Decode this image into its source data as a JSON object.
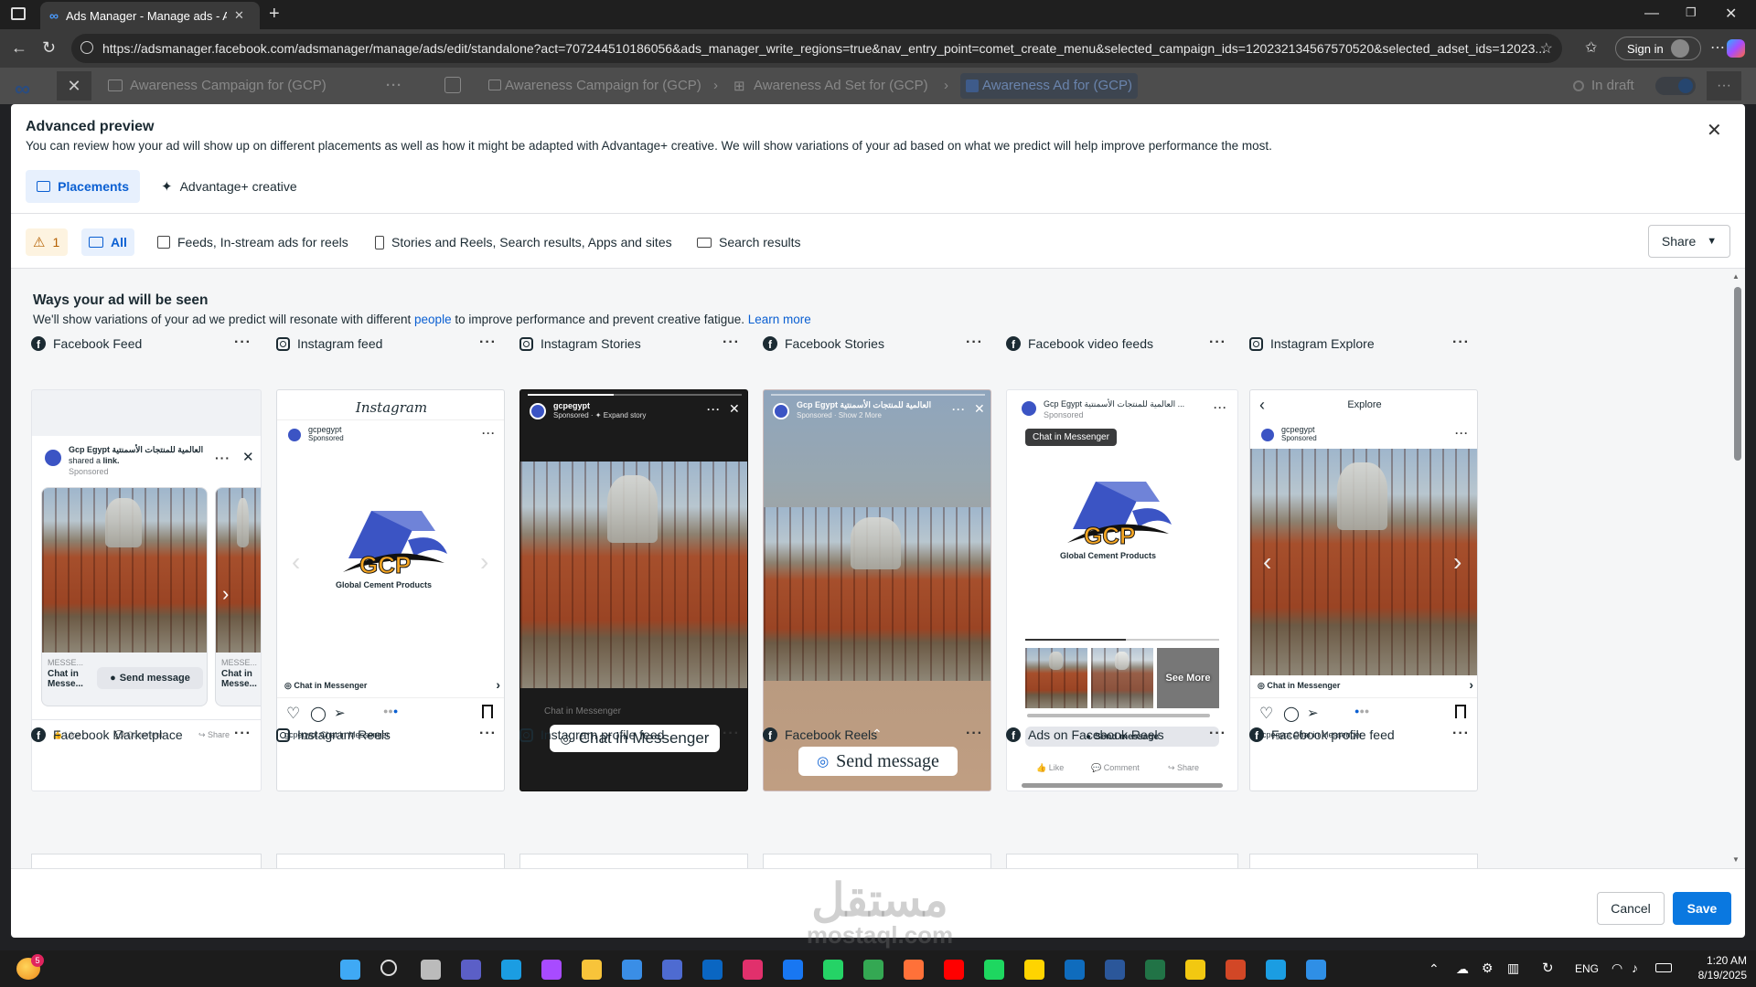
{
  "browser": {
    "tab_title": "Ads Manager - Manage ads - Ads",
    "url": "https://adsmanager.facebook.com/adsmanager/manage/ads/edit/standalone?act=707244510186056&ads_manager_write_regions=true&nav_entry_point=comet_create_menu&selected_campaign_ids=120232134567570520&selected_adset_ids=12023...",
    "signin_label": "Sign in"
  },
  "fb_header": {
    "campaign_tab": "Awareness Campaign for (GCP)",
    "crumb_campaign": "Awareness Campaign for (GCP)",
    "crumb_adset": "Awareness Ad Set for (GCP)",
    "crumb_ad": "Awareness Ad for (GCP)",
    "status": "In draft"
  },
  "modal": {
    "title": "Advanced preview",
    "subtitle": "You can review how your ad will show up on different placements as well as how it might be adapted with Advantage+ creative. We will show variations of your ad based on what we predict will help improve performance the most.",
    "tabs": [
      {
        "label": "Placements"
      },
      {
        "label": "Advantage+ creative"
      }
    ],
    "warning_count": "1",
    "filters": [
      {
        "label": "All"
      },
      {
        "label": "Feeds, In-stream ads for reels"
      },
      {
        "label": "Stories and Reels, Search results, Apps and sites"
      },
      {
        "label": "Search results"
      }
    ],
    "share_label": "Share",
    "section_title": "Ways your ad will be seen",
    "section_sub_pre": "We'll show variations of your ad we predict will resonate with different ",
    "section_sub_link1": "people",
    "section_sub_mid": " to improve performance and prevent creative fatigue. ",
    "section_sub_link2": "Learn more",
    "placements_row1": [
      {
        "label": "Facebook Feed",
        "icon": "facebook-icon"
      },
      {
        "label": "Instagram feed",
        "icon": "instagram-icon"
      },
      {
        "label": "Instagram Stories",
        "icon": "instagram-icon"
      },
      {
        "label": "Facebook Stories",
        "icon": "facebook-icon"
      },
      {
        "label": "Facebook video feeds",
        "icon": "facebook-icon"
      },
      {
        "label": "Instagram Explore",
        "icon": "instagram-icon"
      }
    ],
    "placements_row2": [
      {
        "label": "Facebook Marketplace",
        "icon": "facebook-icon"
      },
      {
        "label": "Instagram Reels",
        "icon": "instagram-icon"
      },
      {
        "label": "Instagram profile feed",
        "icon": "instagram-icon"
      },
      {
        "label": "Facebook Reels",
        "icon": "facebook-icon"
      },
      {
        "label": "Ads on Facebook Reels",
        "icon": "facebook-icon"
      },
      {
        "label": "Facebook profile feed",
        "icon": "facebook-icon"
      }
    ],
    "cancel_label": "Cancel",
    "save_label": "Save"
  },
  "previews": {
    "fb_feed": {
      "page": "Gcp Egypt",
      "arabic": "العالمية للمنتجات الأسمنتية",
      "shared": "shared a",
      "link": "link.",
      "sponsored": "Sponsored",
      "card_source": "MESSE...",
      "card_title": "Chat in Messe...",
      "card2_title": "Chat in Messe...",
      "send": "Send message",
      "like": "Like",
      "comment": "Comment",
      "share": "Share"
    },
    "ig_feed": {
      "brand": "Instagram",
      "account": "gcpegypt",
      "sponsored": "Sponsored",
      "logo_text": "GCP",
      "logo_sub": "Global Cement Products",
      "cta": "Chat in Messenger",
      "caption_user": "gcpegypt",
      "caption": "Chat in Messenger"
    },
    "ig_stories": {
      "account": "gcpegypt",
      "meta": "Sponsored · ✦ Expand story",
      "faint": "Chat in Messenger",
      "cta": "Chat in Messenger"
    },
    "fb_stories": {
      "page": "Gcp Egypt",
      "arabic": "العالمية للمنتجات الأسمنتية",
      "meta": "Sponsored · Show 2 More",
      "cta": "Send message"
    },
    "fb_video": {
      "page": "Gcp Egypt العالمية للمنتجات الأسمنتية ...",
      "sponsored": "Sponsored",
      "badge": "Chat in Messenger",
      "logo_text": "GCP",
      "logo_sub": "Global Cement Products",
      "see_more": "See More",
      "send": "Send message",
      "like": "Like",
      "comment": "Comment",
      "share": "Share"
    },
    "ig_explore": {
      "header": "Explore",
      "account": "gcpegypt",
      "sponsored": "Sponsored",
      "cta": "Chat in Messenger",
      "caption_user": "gcpegypt",
      "caption": "Chat in Messenger"
    }
  },
  "watermark": {
    "arabic": "مستقل",
    "latin": "mostaql.com"
  },
  "taskbar": {
    "lang": "ENG",
    "time": "1:20 AM",
    "date": "8/19/2025",
    "weather_badge": "5"
  },
  "colors": {
    "accent": "#0a5fd2",
    "selected_bg": "#e7f0fd",
    "gcp_blue": "#3b54c4",
    "gcp_orange": "#f5a623"
  }
}
